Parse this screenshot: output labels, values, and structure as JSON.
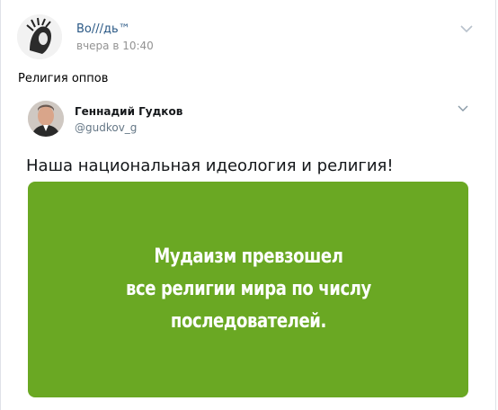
{
  "post": {
    "author": "Во///дь™",
    "time": "вчера в 10:40",
    "text": "Религия оппов"
  },
  "tweet": {
    "name": "Геннадий Гудков",
    "handle": "@gudkov_g",
    "text": "Наша национальная идеология и религия!",
    "image_lines": [
      "Мудаизм превзошел",
      "все религии мира по числу",
      "последователей."
    ],
    "image_bg": "#6aa823"
  },
  "icons": {
    "post_menu": "chevron-down-icon",
    "tweet_menu": "chevron-down-icon"
  }
}
